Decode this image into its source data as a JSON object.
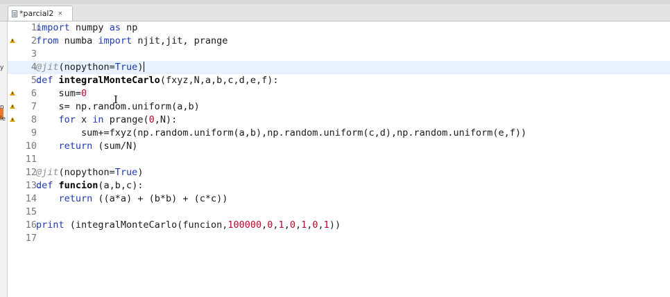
{
  "editor_tab": {
    "title": "*parcial2",
    "close_glyph": "✕",
    "file_icon": "python-file-icon"
  },
  "left_edge": {
    "chars": [
      "y",
      "n",
      "le"
    ]
  },
  "editor": {
    "current_line": 4,
    "warning_lines": [
      2,
      6,
      7,
      8
    ],
    "fold_lines": [
      1,
      5,
      13
    ],
    "lines": [
      {
        "num": "1",
        "tokens": [
          {
            "t": "import",
            "c": "kw"
          },
          {
            "t": " numpy "
          },
          {
            "t": "as",
            "c": "kw"
          },
          {
            "t": " np"
          }
        ]
      },
      {
        "num": "2",
        "tokens": [
          {
            "t": "from",
            "c": "kw"
          },
          {
            "t": " numba "
          },
          {
            "t": "import",
            "c": "kw"
          },
          {
            "t": " njit,jit, prange"
          }
        ]
      },
      {
        "num": "3",
        "tokens": []
      },
      {
        "num": "4",
        "tokens": [
          {
            "t": "@jit",
            "c": "dec"
          },
          {
            "t": "(nopython="
          },
          {
            "t": "True",
            "c": "kw"
          },
          {
            "t": ")"
          }
        ]
      },
      {
        "num": "5",
        "tokens": [
          {
            "t": "def ",
            "c": "kw"
          },
          {
            "t": "integralMonteCarlo",
            "c": "fn"
          },
          {
            "t": "(fxyz,N,a,b,c,d,e,f):"
          }
        ]
      },
      {
        "num": "6",
        "tokens": [
          {
            "t": "    sum="
          },
          {
            "t": "0",
            "c": "num"
          }
        ]
      },
      {
        "num": "7",
        "tokens": [
          {
            "t": "    s= np.random.uniform(a,b)"
          }
        ]
      },
      {
        "num": "8",
        "tokens": [
          {
            "t": "    "
          },
          {
            "t": "for",
            "c": "kw"
          },
          {
            "t": " x "
          },
          {
            "t": "in",
            "c": "kw"
          },
          {
            "t": " prange("
          },
          {
            "t": "0",
            "c": "num"
          },
          {
            "t": ",N):"
          }
        ]
      },
      {
        "num": "9",
        "tokens": [
          {
            "t": "        sum+=fxyz(np.random.uniform(a,b),np.random.uniform(c,d),np.random.uniform(e,f))"
          }
        ]
      },
      {
        "num": "10",
        "tokens": [
          {
            "t": "    "
          },
          {
            "t": "return",
            "c": "kw"
          },
          {
            "t": " (sum/N)"
          }
        ]
      },
      {
        "num": "11",
        "tokens": []
      },
      {
        "num": "12",
        "tokens": [
          {
            "t": "@jit",
            "c": "dec"
          },
          {
            "t": "(nopython="
          },
          {
            "t": "True",
            "c": "kw"
          },
          {
            "t": ")"
          }
        ]
      },
      {
        "num": "13",
        "tokens": [
          {
            "t": "def ",
            "c": "kw"
          },
          {
            "t": "funcion",
            "c": "fn"
          },
          {
            "t": "(a,b,c):"
          }
        ]
      },
      {
        "num": "14",
        "tokens": [
          {
            "t": "    "
          },
          {
            "t": "return",
            "c": "kw"
          },
          {
            "t": " ((a*a) + (b*b) + (c*c))"
          }
        ]
      },
      {
        "num": "15",
        "tokens": []
      },
      {
        "num": "16",
        "tokens": [
          {
            "t": "print",
            "c": "kw"
          },
          {
            "t": " (integralMonteCarlo(funcion,"
          },
          {
            "t": "100000",
            "c": "num"
          },
          {
            "t": ","
          },
          {
            "t": "0",
            "c": "num"
          },
          {
            "t": ","
          },
          {
            "t": "1",
            "c": "num"
          },
          {
            "t": ","
          },
          {
            "t": "0",
            "c": "num"
          },
          {
            "t": ","
          },
          {
            "t": "1",
            "c": "num"
          },
          {
            "t": ","
          },
          {
            "t": "0",
            "c": "num"
          },
          {
            "t": ","
          },
          {
            "t": "1",
            "c": "num"
          },
          {
            "t": "))"
          }
        ]
      },
      {
        "num": "17",
        "tokens": []
      }
    ]
  }
}
